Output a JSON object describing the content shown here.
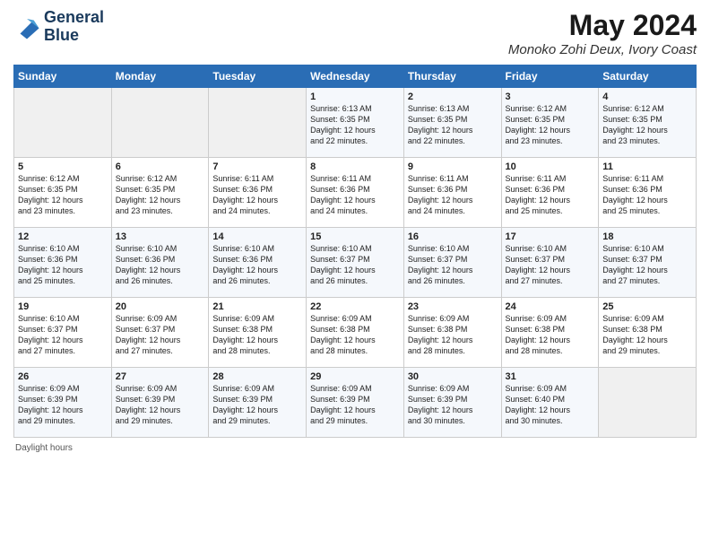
{
  "header": {
    "logo_line1": "General",
    "logo_line2": "Blue",
    "main_title": "May 2024",
    "sub_title": "Monoko Zohi Deux, Ivory Coast"
  },
  "days_of_week": [
    "Sunday",
    "Monday",
    "Tuesday",
    "Wednesday",
    "Thursday",
    "Friday",
    "Saturday"
  ],
  "weeks": [
    [
      {
        "day": "",
        "info": ""
      },
      {
        "day": "",
        "info": ""
      },
      {
        "day": "",
        "info": ""
      },
      {
        "day": "1",
        "info": "Sunrise: 6:13 AM\nSunset: 6:35 PM\nDaylight: 12 hours\nand 22 minutes."
      },
      {
        "day": "2",
        "info": "Sunrise: 6:13 AM\nSunset: 6:35 PM\nDaylight: 12 hours\nand 22 minutes."
      },
      {
        "day": "3",
        "info": "Sunrise: 6:12 AM\nSunset: 6:35 PM\nDaylight: 12 hours\nand 23 minutes."
      },
      {
        "day": "4",
        "info": "Sunrise: 6:12 AM\nSunset: 6:35 PM\nDaylight: 12 hours\nand 23 minutes."
      }
    ],
    [
      {
        "day": "5",
        "info": "Sunrise: 6:12 AM\nSunset: 6:35 PM\nDaylight: 12 hours\nand 23 minutes."
      },
      {
        "day": "6",
        "info": "Sunrise: 6:12 AM\nSunset: 6:35 PM\nDaylight: 12 hours\nand 23 minutes."
      },
      {
        "day": "7",
        "info": "Sunrise: 6:11 AM\nSunset: 6:36 PM\nDaylight: 12 hours\nand 24 minutes."
      },
      {
        "day": "8",
        "info": "Sunrise: 6:11 AM\nSunset: 6:36 PM\nDaylight: 12 hours\nand 24 minutes."
      },
      {
        "day": "9",
        "info": "Sunrise: 6:11 AM\nSunset: 6:36 PM\nDaylight: 12 hours\nand 24 minutes."
      },
      {
        "day": "10",
        "info": "Sunrise: 6:11 AM\nSunset: 6:36 PM\nDaylight: 12 hours\nand 25 minutes."
      },
      {
        "day": "11",
        "info": "Sunrise: 6:11 AM\nSunset: 6:36 PM\nDaylight: 12 hours\nand 25 minutes."
      }
    ],
    [
      {
        "day": "12",
        "info": "Sunrise: 6:10 AM\nSunset: 6:36 PM\nDaylight: 12 hours\nand 25 minutes."
      },
      {
        "day": "13",
        "info": "Sunrise: 6:10 AM\nSunset: 6:36 PM\nDaylight: 12 hours\nand 26 minutes."
      },
      {
        "day": "14",
        "info": "Sunrise: 6:10 AM\nSunset: 6:36 PM\nDaylight: 12 hours\nand 26 minutes."
      },
      {
        "day": "15",
        "info": "Sunrise: 6:10 AM\nSunset: 6:37 PM\nDaylight: 12 hours\nand 26 minutes."
      },
      {
        "day": "16",
        "info": "Sunrise: 6:10 AM\nSunset: 6:37 PM\nDaylight: 12 hours\nand 26 minutes."
      },
      {
        "day": "17",
        "info": "Sunrise: 6:10 AM\nSunset: 6:37 PM\nDaylight: 12 hours\nand 27 minutes."
      },
      {
        "day": "18",
        "info": "Sunrise: 6:10 AM\nSunset: 6:37 PM\nDaylight: 12 hours\nand 27 minutes."
      }
    ],
    [
      {
        "day": "19",
        "info": "Sunrise: 6:10 AM\nSunset: 6:37 PM\nDaylight: 12 hours\nand 27 minutes."
      },
      {
        "day": "20",
        "info": "Sunrise: 6:09 AM\nSunset: 6:37 PM\nDaylight: 12 hours\nand 27 minutes."
      },
      {
        "day": "21",
        "info": "Sunrise: 6:09 AM\nSunset: 6:38 PM\nDaylight: 12 hours\nand 28 minutes."
      },
      {
        "day": "22",
        "info": "Sunrise: 6:09 AM\nSunset: 6:38 PM\nDaylight: 12 hours\nand 28 minutes."
      },
      {
        "day": "23",
        "info": "Sunrise: 6:09 AM\nSunset: 6:38 PM\nDaylight: 12 hours\nand 28 minutes."
      },
      {
        "day": "24",
        "info": "Sunrise: 6:09 AM\nSunset: 6:38 PM\nDaylight: 12 hours\nand 28 minutes."
      },
      {
        "day": "25",
        "info": "Sunrise: 6:09 AM\nSunset: 6:38 PM\nDaylight: 12 hours\nand 29 minutes."
      }
    ],
    [
      {
        "day": "26",
        "info": "Sunrise: 6:09 AM\nSunset: 6:39 PM\nDaylight: 12 hours\nand 29 minutes."
      },
      {
        "day": "27",
        "info": "Sunrise: 6:09 AM\nSunset: 6:39 PM\nDaylight: 12 hours\nand 29 minutes."
      },
      {
        "day": "28",
        "info": "Sunrise: 6:09 AM\nSunset: 6:39 PM\nDaylight: 12 hours\nand 29 minutes."
      },
      {
        "day": "29",
        "info": "Sunrise: 6:09 AM\nSunset: 6:39 PM\nDaylight: 12 hours\nand 29 minutes."
      },
      {
        "day": "30",
        "info": "Sunrise: 6:09 AM\nSunset: 6:39 PM\nDaylight: 12 hours\nand 30 minutes."
      },
      {
        "day": "31",
        "info": "Sunrise: 6:09 AM\nSunset: 6:40 PM\nDaylight: 12 hours\nand 30 minutes."
      },
      {
        "day": "",
        "info": ""
      }
    ]
  ],
  "footer": {
    "daylight_label": "Daylight hours"
  }
}
